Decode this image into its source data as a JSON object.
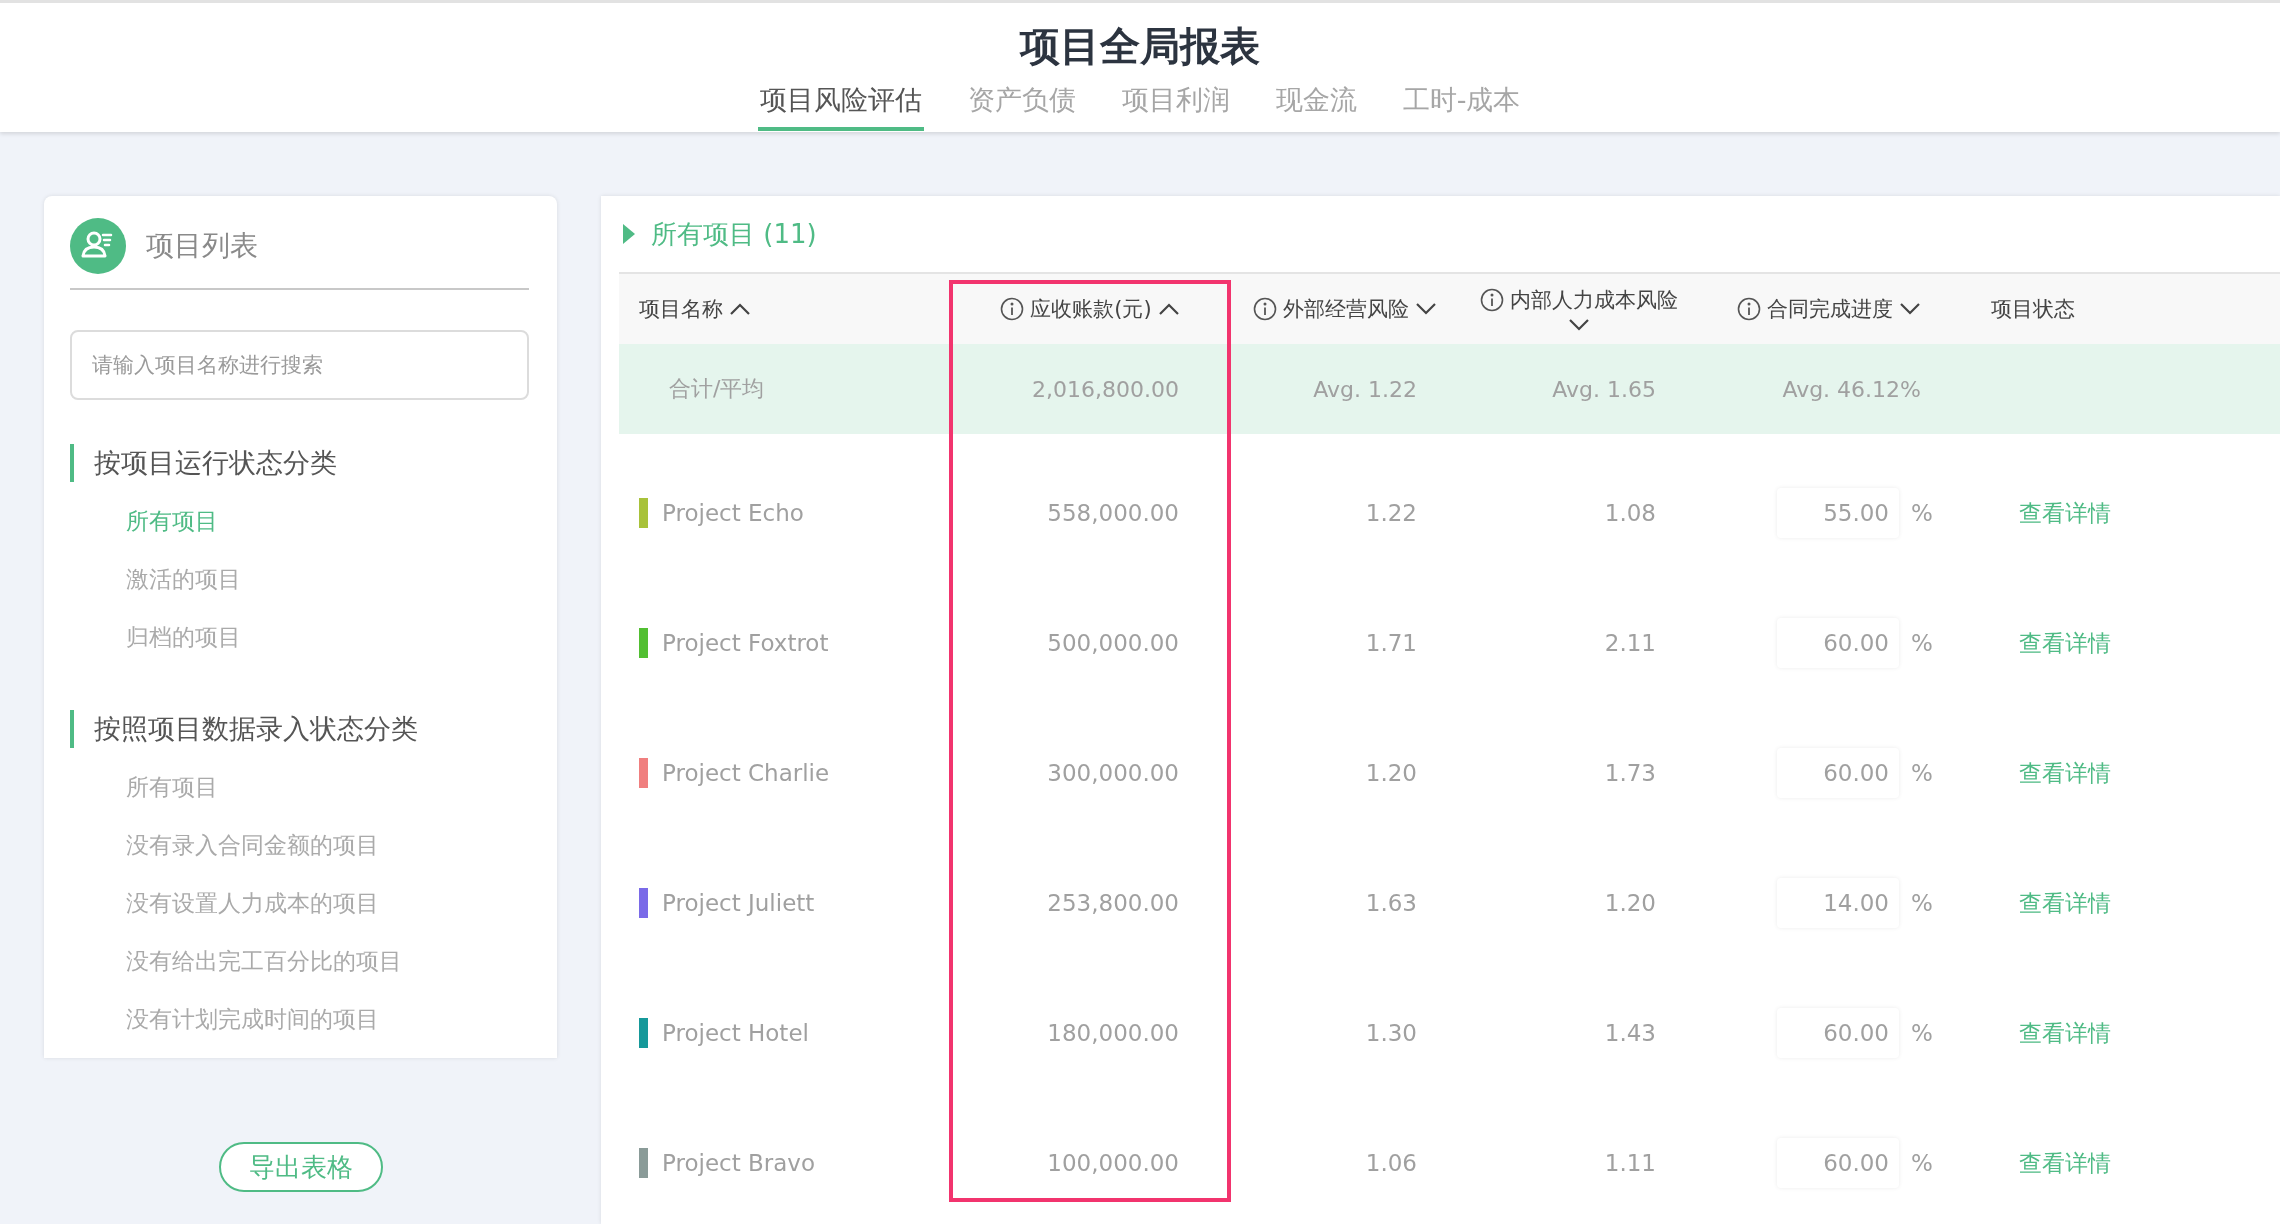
{
  "header": {
    "title": "项目全局报表",
    "tabs": [
      {
        "label": "项目风险评估",
        "selected": true
      },
      {
        "label": "资产负债",
        "selected": false
      },
      {
        "label": "项目利润",
        "selected": false
      },
      {
        "label": "现金流",
        "selected": false
      },
      {
        "label": "工时-成本",
        "selected": false
      }
    ]
  },
  "sidebar": {
    "title": "项目列表",
    "search": {
      "placeholder": "请输入项目名称进行搜索"
    },
    "groups": [
      {
        "title": "按项目运行状态分类",
        "items": [
          {
            "label": "所有项目",
            "selected": true
          },
          {
            "label": "激活的项目",
            "selected": false
          },
          {
            "label": "归档的项目",
            "selected": false
          }
        ]
      },
      {
        "title": "按照项目数据录入状态分类",
        "items": [
          {
            "label": "所有项目",
            "selected": false
          },
          {
            "label": "没有录入合同金额的项目",
            "selected": false
          },
          {
            "label": "没有设置人力成本的项目",
            "selected": false
          },
          {
            "label": "没有给出完工百分比的项目",
            "selected": false
          },
          {
            "label": "没有计划完成时间的项目",
            "selected": false
          }
        ]
      }
    ],
    "export_button": "导出表格"
  },
  "table": {
    "title": "所有项目 (11)",
    "columns": [
      {
        "label": "项目名称",
        "info": false,
        "sortable": true,
        "ascending": true,
        "highlighted": false
      },
      {
        "label": "应收账款(元)",
        "info": true,
        "sortable": true,
        "ascending": true,
        "highlighted": true
      },
      {
        "label": "外部经营风险",
        "info": true,
        "sortable": true,
        "ascending": false,
        "highlighted": false
      },
      {
        "label": "内部人力成本风险",
        "info": true,
        "sortable": true,
        "ascending": false,
        "highlighted": false
      },
      {
        "label": "合同完成进度",
        "info": true,
        "sortable": true,
        "ascending": false,
        "highlighted": false
      },
      {
        "label": "项目状态",
        "info": false,
        "sortable": false,
        "highlighted": false
      }
    ],
    "summary": [
      "合计/平均",
      "2,016,800.00",
      "Avg. 1.22",
      "Avg. 1.65",
      "Avg. 46.12%"
    ],
    "rows": [
      {
        "name": "Project Echo",
        "color": "#a8c23a",
        "receivable": "558,000.00",
        "external_risk": "1.22",
        "internal_risk": "1.08",
        "progress": "55.00",
        "unit": "%",
        "action": "查看详情"
      },
      {
        "name": "Project Foxtrot",
        "color": "#52bf32",
        "receivable": "500,000.00",
        "external_risk": "1.71",
        "internal_risk": "2.11",
        "progress": "60.00",
        "unit": "%",
        "action": "查看详情"
      },
      {
        "name": "Project Charlie",
        "color": "#f07f7f",
        "receivable": "300,000.00",
        "external_risk": "1.20",
        "internal_risk": "1.73",
        "progress": "60.00",
        "unit": "%",
        "action": "查看详情"
      },
      {
        "name": "Project Juliett",
        "color": "#7a6ae8",
        "receivable": "253,800.00",
        "external_risk": "1.63",
        "internal_risk": "1.20",
        "progress": "14.00",
        "unit": "%",
        "action": "查看详情"
      },
      {
        "name": "Project Hotel",
        "color": "#16999a",
        "receivable": "180,000.00",
        "external_risk": "1.30",
        "internal_risk": "1.43",
        "progress": "60.00",
        "unit": "%",
        "action": "查看详情"
      },
      {
        "name": "Project Bravo",
        "color": "#8a9b98",
        "receivable": "100,000.00",
        "external_risk": "1.06",
        "internal_risk": "1.11",
        "progress": "60.00",
        "unit": "%",
        "action": "查看详情"
      }
    ]
  }
}
